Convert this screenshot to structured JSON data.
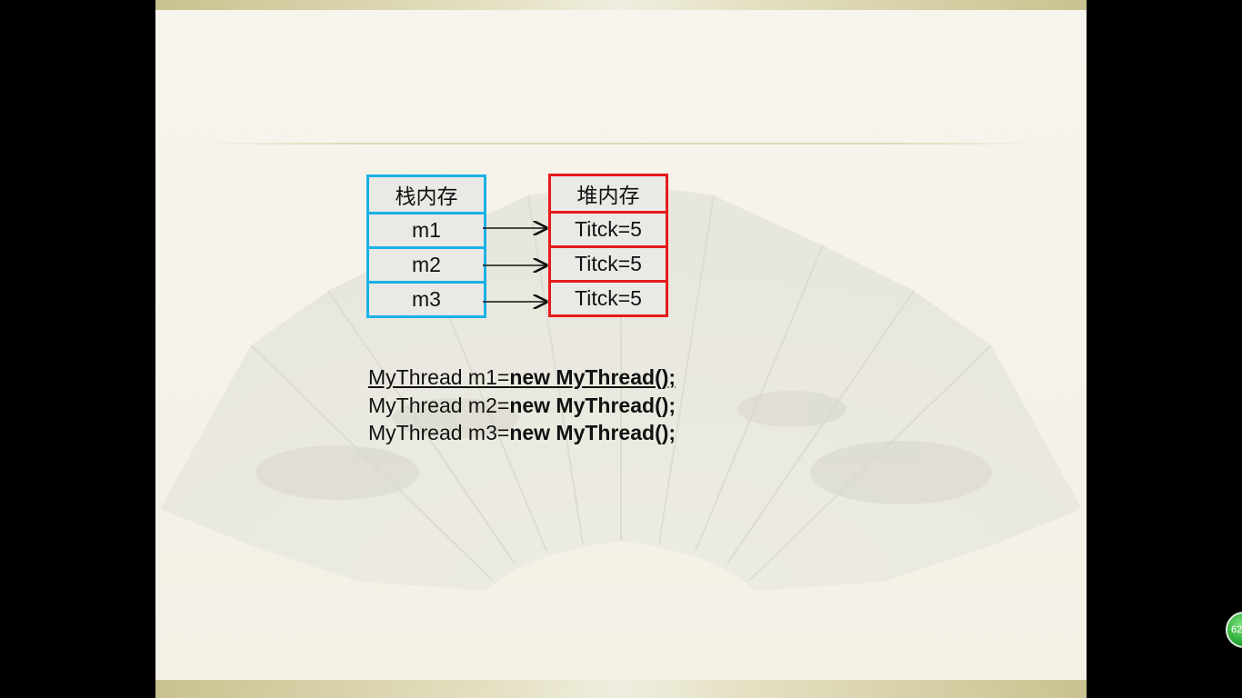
{
  "diagram": {
    "stack": {
      "title": "栈内存",
      "cells": [
        "m1",
        "m2",
        "m3"
      ]
    },
    "heap": {
      "title": "堆内存",
      "cells": [
        "Titck=5",
        "Titck=5",
        "Titck=5"
      ]
    }
  },
  "code": [
    {
      "var": "MyThread m1=",
      "rest": "new MyThread();"
    },
    {
      "var": "MyThread m2=",
      "rest": "new MyThread();"
    },
    {
      "var": "MyThread m3=",
      "rest": "new MyThread();"
    }
  ],
  "page_badge": "62",
  "colors": {
    "stack_border": "#19b1e6",
    "heap_border": "#e41b1b",
    "cell_fill": "#e9e9e6",
    "background": "#000000"
  }
}
